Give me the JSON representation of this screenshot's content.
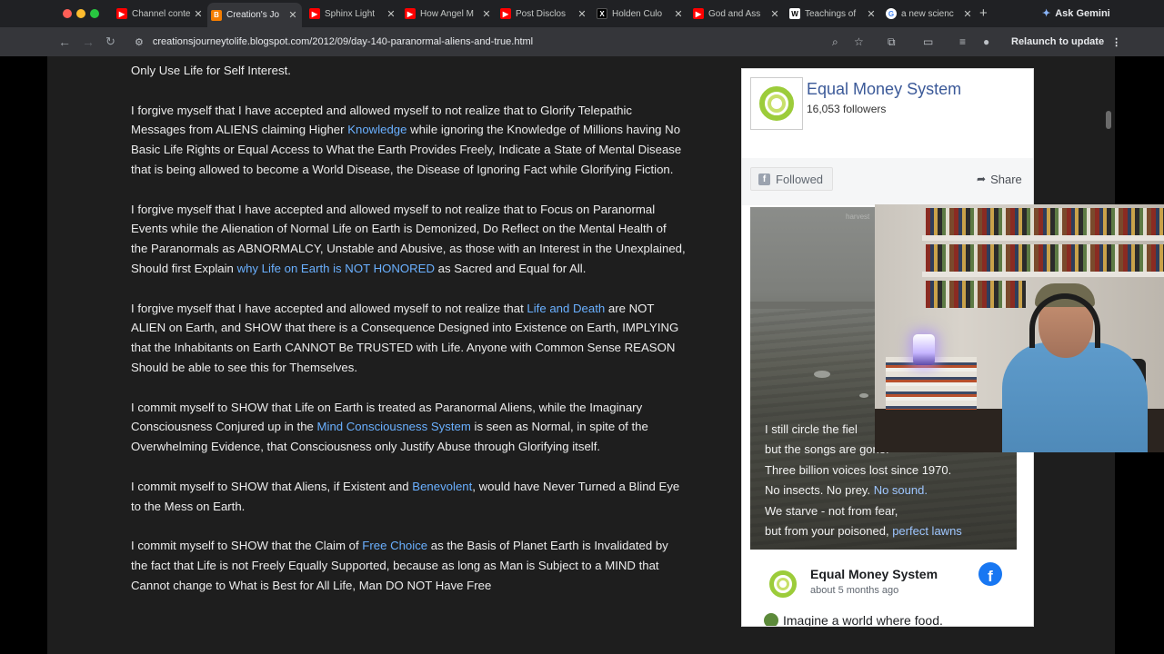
{
  "browser": {
    "tabs": [
      {
        "title": "Channel conte",
        "icon": "youtube-icon",
        "color": "#ff0000",
        "active": false
      },
      {
        "title": "Creation's Jo",
        "icon": "blogger-icon",
        "color": "#f57d00",
        "active": true
      },
      {
        "title": "Sphinx Light",
        "icon": "youtube-icon",
        "color": "#ff0000",
        "active": false
      },
      {
        "title": "How Angel M",
        "icon": "youtube-icon",
        "color": "#ff0000",
        "active": false
      },
      {
        "title": "Post Disclos",
        "icon": "youtube-icon",
        "color": "#ff0000",
        "active": false
      },
      {
        "title": "Holden Culo",
        "icon": "x-icon",
        "color": "#000000",
        "active": false
      },
      {
        "title": "God and Ass",
        "icon": "youtube-icon",
        "color": "#ff0000",
        "active": false
      },
      {
        "title": "Teachings of",
        "icon": "wikipedia-icon",
        "color": "#ffffff",
        "active": false
      },
      {
        "title": "a new scienc",
        "icon": "google-icon",
        "color": "#ffffff",
        "active": false
      }
    ],
    "ask_gemini": "Ask Gemini",
    "url": "creationsjourneytolife.blogspot.com/2012/09/day-140-paranormal-aliens-and-true.html",
    "relaunch": "Relaunch to update"
  },
  "post": {
    "paragraphs": [
      {
        "pre": "Only Use Life for Self Interest.",
        "link": "",
        "post": ""
      },
      {
        "pre": "I forgive myself that I have accepted and allowed myself to not realize that to Glorify Telepathic Messages from ALIENS claiming Higher ",
        "link": "Knowledge",
        "post": " while ignoring the Knowledge of Millions having No Basic Life Rights or Equal Access to What the Earth Provides Freely, Indicate a State of Mental Disease that is being allowed to become a World Disease, the Disease of Ignoring Fact while Glorifying Fiction."
      },
      {
        "pre": "I forgive myself that I have accepted and allowed myself to not realize that to Focus on Paranormal Events while the Alienation of Normal Life on Earth is Demonized, Do Reflect on the Mental Health of the Paranormals as ABNORMALCY, Unstable and Abusive, as those with an Interest in the Unexplained, Should first Explain ",
        "link": "why Life on Earth is NOT HONORED",
        "post": " as Sacred and Equal for All."
      },
      {
        "pre": "I forgive myself that I have accepted and allowed myself to not realize that ",
        "link": "Life and Death",
        "post": " are NOT ALIEN on Earth, and SHOW that there is a Consequence Designed into Existence on Earth, IMPLYING that the Inhabitants on Earth CANNOT Be TRUSTED with Life. Anyone with Common Sense REASON Should be able to see this for Themselves."
      },
      {
        "pre": "I commit myself to SHOW that Life on Earth is treated as Paranormal Aliens, while the Imaginary Consciousness Conjured up in the ",
        "link": "Mind Consciousness System",
        "post": " is seen as Normal, in spite of the Overwhelming Evidence, that Consciousness only Justify Abuse through Glorifying itself."
      },
      {
        "pre": "I commit myself to SHOW that Aliens, if Existent and ",
        "link": "Benevolent",
        "post": ", would have Never Turned a Blind Eye to the Mess on Earth."
      },
      {
        "pre": "I commit myself to SHOW that the Claim of ",
        "link": "Free Choice",
        "post": " as the Basis of Planet Earth is Invalidated by the fact that Life is not Freely Equally Supported, because as long as Man is Subject to a MIND that Cannot change to What is Best for All Life, Man DO NOT Have Free"
      }
    ]
  },
  "fb_widget": {
    "page_name": "Equal Money System",
    "followers": "16,053 followers",
    "followed_label": "Followed",
    "share_label": "Share",
    "video_watermark": "harvest",
    "caption_lines": [
      {
        "text": "I still circle the fiel",
        "highlight": ""
      },
      {
        "text": "but the songs are gone.",
        "highlight": ""
      },
      {
        "text": "Three billion voices lost since 1970.",
        "highlight": ""
      },
      {
        "text": "No insects. No prey. ",
        "highlight": "No sound."
      },
      {
        "text": "We starve - not from fear,",
        "highlight": ""
      },
      {
        "text": "but from your poisoned, ",
        "highlight": "perfect lawns"
      }
    ],
    "post_author": "Equal Money System",
    "post_time": "about 5 months ago",
    "post_text": "Imagine a world where food."
  },
  "colors": {
    "link": "#6ab0ff",
    "fb_blue": "#1877f2",
    "logo_green": "#9ccc3a"
  }
}
